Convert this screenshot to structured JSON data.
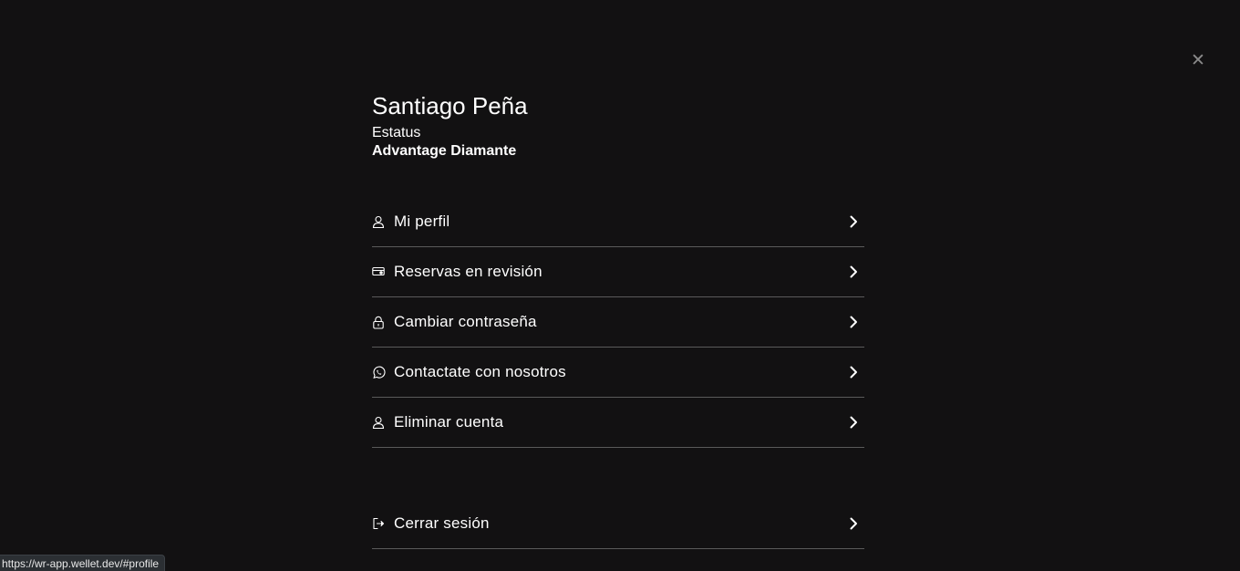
{
  "close": {
    "icon": "close-icon"
  },
  "user": {
    "name": "Santiago Peña",
    "status_label": "Estatus",
    "status_value": "Advantage Diamante"
  },
  "menu": {
    "items": [
      {
        "label": "Mi perfil",
        "icon": "user-icon"
      },
      {
        "label": "Reservas en revisión",
        "icon": "ticket-icon"
      },
      {
        "label": "Cambiar contraseña",
        "icon": "lock-icon"
      },
      {
        "label": "Contactate con nosotros",
        "icon": "whatsapp-icon"
      },
      {
        "label": "Eliminar cuenta",
        "icon": "user-icon"
      }
    ],
    "logout": {
      "label": "Cerrar sesión",
      "icon": "logout-icon"
    }
  },
  "status_bar": {
    "url": "https://wr-app.wellet.dev/#profile"
  },
  "colors": {
    "background": "#121112",
    "divider": "#5a5a5a",
    "text": "#ffffff"
  }
}
